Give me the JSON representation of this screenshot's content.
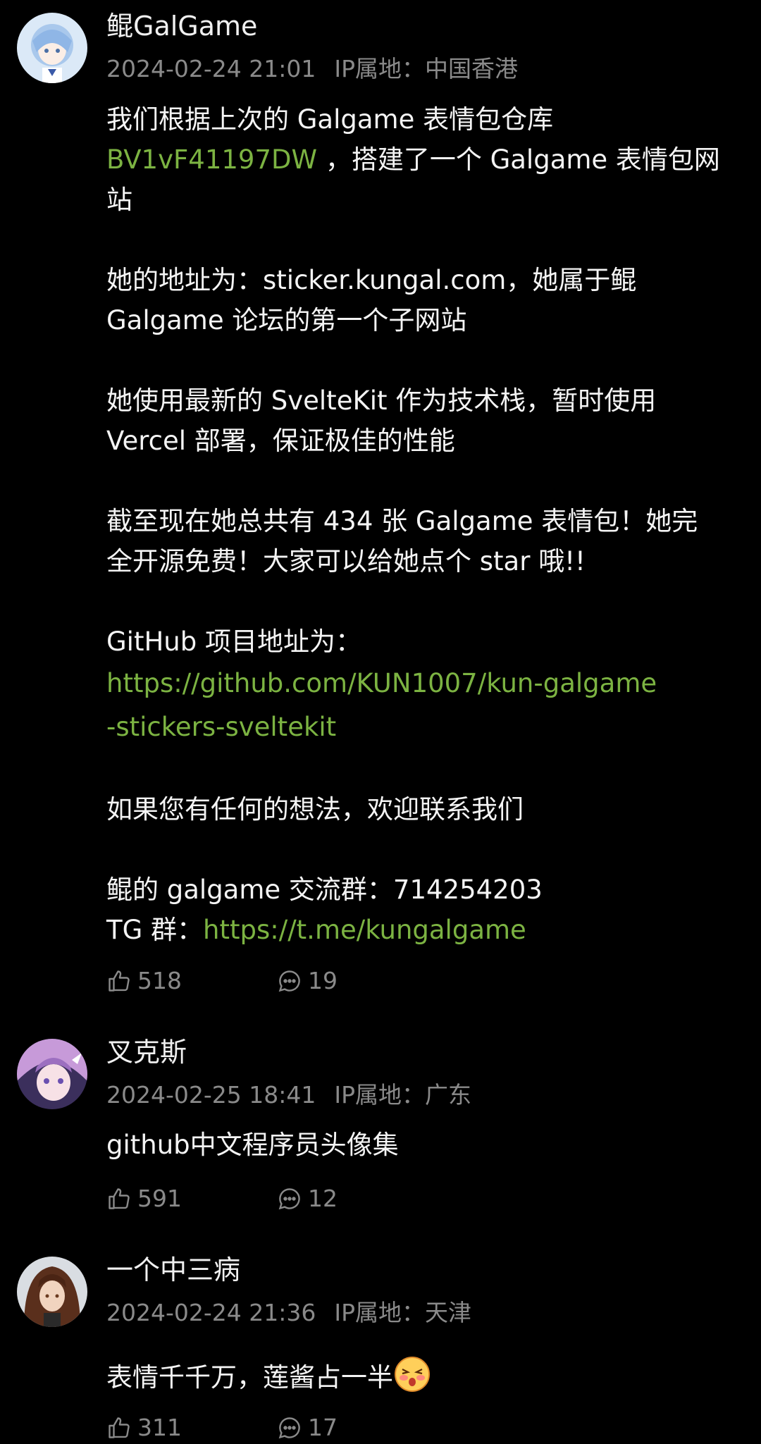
{
  "comments": [
    {
      "username": "鲲GalGame",
      "date": "2024-02-24 21:01",
      "ip_label": "IP属地：中国香港",
      "lines": [
        {
          "t": "我们根据上次的 Galgame 表情包仓库"
        },
        {
          "link": "BV1vF41197DW",
          "t": " ，搭建了一个 Galgame 表情包网"
        },
        {
          "t": "站"
        },
        {
          "blank": true
        },
        {
          "t": "她的地址为：sticker.kungal.com，她属于鲲"
        },
        {
          "t": "Galgame 论坛的第一个子网站"
        },
        {
          "blank": true
        },
        {
          "t": "她使用最新的 SvelteKit 作为技术栈，暂时使用"
        },
        {
          "t": "Vercel 部署，保证极佳的性能"
        },
        {
          "blank": true
        },
        {
          "t": "截至现在她总共有 434 张 Galgame 表情包！她完"
        },
        {
          "t": "全开源免费！大家可以给她点个 star 哦!!"
        },
        {
          "blank": true
        },
        {
          "t": "GitHub 项目地址为："
        },
        {
          "link": "https://github.com/KUN1007/kun-galgame"
        },
        {
          "link": "-stickers-sveltekit"
        },
        {
          "blank": true
        },
        {
          "t": "如果您有任何的想法，欢迎联系我们"
        },
        {
          "blank": true
        },
        {
          "t": "鲲的 galgame 交流群：714254203"
        },
        {
          "t": "TG 群：",
          "link": "https://t.me/kungalgame"
        }
      ],
      "likes": "518",
      "replies": "19"
    },
    {
      "username": "叉克斯",
      "date": "2024-02-25 18:41",
      "ip_label": "IP属地：广东",
      "lines": [
        {
          "t": "github中文程序员头像集"
        }
      ],
      "likes": "591",
      "replies": "12"
    },
    {
      "username": "一个中三病",
      "date": "2024-02-24 21:36",
      "ip_label": "IP属地：天津",
      "lines": [
        {
          "t": "表情千千万，莲酱占一半",
          "emoji": "blushing-emoji"
        }
      ],
      "likes": "311",
      "replies": "17"
    }
  ],
  "colors": {
    "link": "#7cb342",
    "meta": "#8a8a8a",
    "background": "#000000"
  },
  "icons": {
    "like": "thumbs-up-icon",
    "reply": "speech-bubble-icon"
  }
}
